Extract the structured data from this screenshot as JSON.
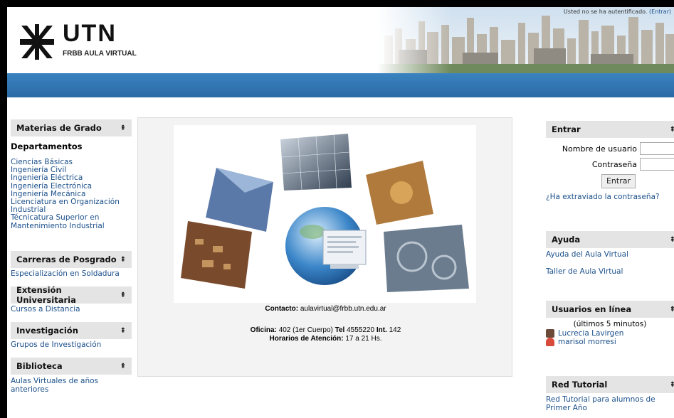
{
  "header": {
    "logo_title": "UTN",
    "logo_subtitle": "FRBB AULA VIRTUAL",
    "login_status_text": "Usted no se ha autentificado.",
    "login_link": "(Entrar)"
  },
  "left": {
    "materias": {
      "title": "Materias de Grado",
      "arrow": "⇞",
      "subtitle": "Departamentos",
      "items": [
        "Ciencias Básicas",
        "Ingeniería Civil",
        "Ingeniería Eléctrica",
        "Ingeniería Electrónica",
        "Ingeniería Mecánica",
        "Licenciatura en Organización Industrial",
        "Técnicatura Superior en Mantenimiento Industrial"
      ]
    },
    "posgrado": {
      "title": "Carreras de Posgrado",
      "arrow": "⇞",
      "items": [
        "Especialización en Soldadura"
      ]
    },
    "extension": {
      "title": "Extensión Universitaria",
      "arrow": "⇞",
      "items": [
        "Cursos a Distancia"
      ]
    },
    "investigacion": {
      "title": "Investigación",
      "arrow": "⇞",
      "items": [
        "Grupos de Investigación"
      ]
    },
    "biblioteca": {
      "title": "Biblioteca",
      "arrow": "⇞",
      "items": [
        "Aulas Virtuales de años anteriores"
      ]
    }
  },
  "center": {
    "contact_label": "Contacto:",
    "contact_email": "aulavirtual@frbb.utn.edu.ar",
    "office_label": "Oficina:",
    "office_value": "402 (1er Cuerpo)",
    "tel_label": "Tel",
    "tel_value": "4555220",
    "int_label": "Int.",
    "int_value": "142",
    "hours_label": "Horarios de Atención:",
    "hours_value": "17 a 21 Hs."
  },
  "right": {
    "entrar": {
      "title": "Entrar",
      "arrow": "⇞",
      "username_label": "Nombre de usuario",
      "password_label": "Contraseña",
      "button_label": "Entrar",
      "forgot_link": "¿Ha extraviado la contraseña?"
    },
    "ayuda": {
      "title": "Ayuda",
      "arrow": "⇞",
      "items": [
        "Ayuda del Aula Virtual",
        "Taller de Aula Virtual"
      ]
    },
    "usuarios": {
      "title": "Usuarios en línea",
      "arrow": "⇞",
      "subtitle": "(últimos 5 minutos)",
      "users": [
        "Lucrecia Lavirgen",
        "marisol morresi"
      ]
    },
    "red": {
      "title": "Red Tutorial",
      "arrow": "⇞",
      "items": [
        "Red Tutorial para alumnos de Primer Año"
      ]
    }
  },
  "colors": {
    "accent_bar": "#2f74b2",
    "link": "#1a4f8a",
    "block_header": "#e4e4e4"
  },
  "icons": [
    "utn-logo-icon",
    "collapse-arrow-icon",
    "user-avatar-icon"
  ]
}
